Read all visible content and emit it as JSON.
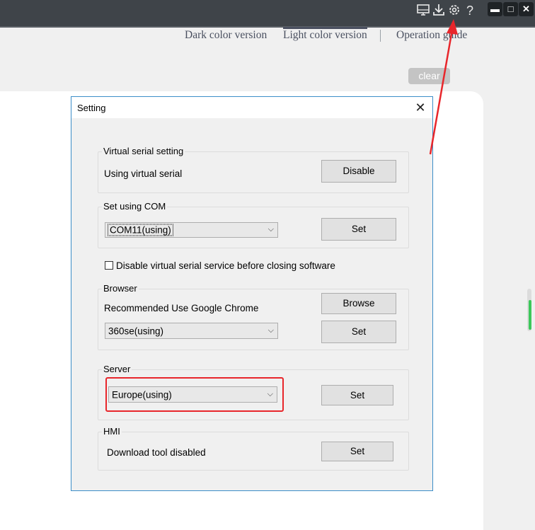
{
  "topbar": {
    "icons": [
      "monitor-icon",
      "download-icon",
      "gear-icon",
      "help-icon"
    ],
    "help_glyph": "?",
    "window_buttons": {
      "minimize": "▬",
      "maximize": "□",
      "close": "✕"
    }
  },
  "tabs": [
    {
      "label": "Dark color version"
    },
    {
      "label": "Light color version",
      "active": true
    },
    {
      "label": "Operation guide"
    }
  ],
  "clear_label": "clear",
  "dialog": {
    "title": "Setting",
    "close_glyph": "✕",
    "virtual_serial": {
      "legend": "Virtual serial setting",
      "status": "Using virtual serial",
      "button": "Disable"
    },
    "com": {
      "legend": "Set using COM",
      "selected": "COM11(using)",
      "button": "Set"
    },
    "disable_checkbox_label": "Disable virtual serial service before closing software",
    "browser": {
      "legend": "Browser",
      "hint": "Recommended Use Google Chrome",
      "browse_button": "Browse",
      "selected": "360se(using)",
      "set_button": "Set"
    },
    "server": {
      "legend": "Server",
      "selected": "Europe(using)",
      "button": "Set"
    },
    "hmi": {
      "legend": "HMI",
      "status": "Download tool disabled",
      "button": "Set"
    }
  },
  "colors": {
    "accent_border": "#3c8ec8",
    "highlight_red": "#e8262b",
    "topbar": "#3f4449"
  }
}
